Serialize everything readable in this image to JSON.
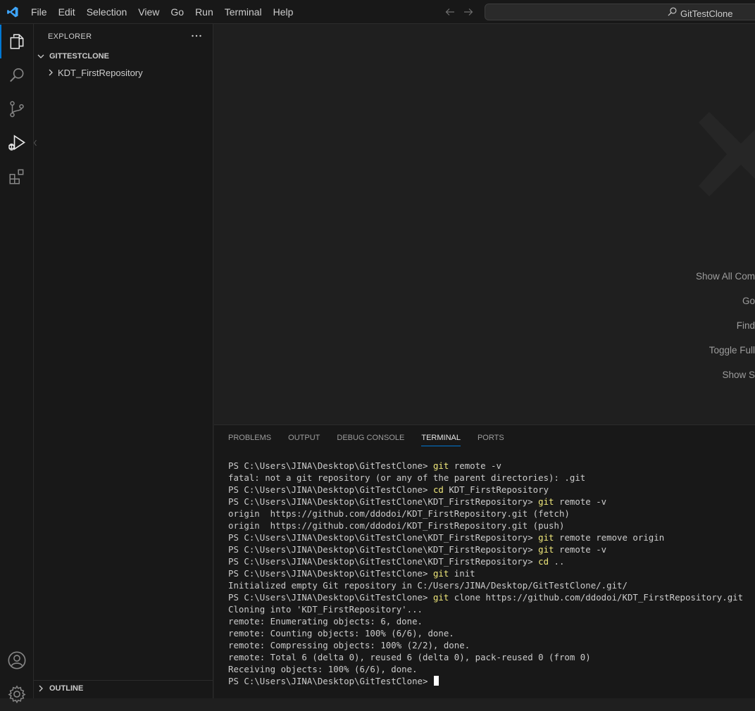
{
  "titlebar": {
    "menu": [
      "File",
      "Edit",
      "Selection",
      "View",
      "Go",
      "Run",
      "Terminal",
      "Help"
    ],
    "command_center": "GitTestClone"
  },
  "colors": {
    "accent": "#0078d4",
    "app_logo": "#3ea6ff",
    "command": "#f0e87b"
  },
  "activity_bar": {
    "icons": [
      "explorer-icon",
      "search-icon",
      "source-control-icon",
      "run-debug-icon",
      "extensions-icon"
    ],
    "bottom_icons": [
      "account-icon",
      "settings-gear-icon"
    ]
  },
  "sidebar": {
    "title": "EXPLORER",
    "more_icon": "ellipsis-icon",
    "workspace": "GITTESTCLONE",
    "items": [
      {
        "label": "KDT_FirstRepository"
      }
    ],
    "outline": "OUTLINE"
  },
  "editor": {
    "shortcuts": [
      "Show All Com",
      "Go",
      "Find",
      "Toggle Full",
      "Show S"
    ]
  },
  "panel": {
    "tabs": [
      "PROBLEMS",
      "OUTPUT",
      "DEBUG CONSOLE",
      "TERMINAL",
      "PORTS"
    ],
    "active_tab": "TERMINAL",
    "terminal_lines": [
      {
        "prompt": "PS C:\\Users\\JINA\\Desktop\\GitTestClone> ",
        "git": "git",
        "rest": " remote -v"
      },
      {
        "text": "fatal: not a git repository (or any of the parent directories): .git"
      },
      {
        "prompt": "PS C:\\Users\\JINA\\Desktop\\GitTestClone> ",
        "git": "cd",
        "rest": " KDT_FirstRepository"
      },
      {
        "prompt": "PS C:\\Users\\JINA\\Desktop\\GitTestClone\\KDT_FirstRepository> ",
        "git": "git",
        "rest": " remote -v"
      },
      {
        "text": "origin  https://github.com/ddodoi/KDT_FirstRepository.git (fetch)"
      },
      {
        "text": "origin  https://github.com/ddodoi/KDT_FirstRepository.git (push)"
      },
      {
        "prompt": "PS C:\\Users\\JINA\\Desktop\\GitTestClone\\KDT_FirstRepository> ",
        "git": "git",
        "rest": " remote remove origin"
      },
      {
        "prompt": "PS C:\\Users\\JINA\\Desktop\\GitTestClone\\KDT_FirstRepository> ",
        "git": "git",
        "rest": " remote -v"
      },
      {
        "prompt": "PS C:\\Users\\JINA\\Desktop\\GitTestClone\\KDT_FirstRepository> ",
        "git": "cd",
        "rest": " .."
      },
      {
        "prompt": "PS C:\\Users\\JINA\\Desktop\\GitTestClone> ",
        "git": "git",
        "rest": " init"
      },
      {
        "text": "Initialized empty Git repository in C:/Users/JINA/Desktop/GitTestClone/.git/"
      },
      {
        "prompt": "PS C:\\Users\\JINA\\Desktop\\GitTestClone> ",
        "git": "git",
        "rest": " clone https://github.com/ddodoi/KDT_FirstRepository.git"
      },
      {
        "text": "Cloning into 'KDT_FirstRepository'..."
      },
      {
        "text": "remote: Enumerating objects: 6, done."
      },
      {
        "text": "remote: Counting objects: 100% (6/6), done."
      },
      {
        "text": "remote: Compressing objects: 100% (2/2), done."
      },
      {
        "text": "remote: Total 6 (delta 0), reused 6 (delta 0), pack-reused 0 (from 0)"
      },
      {
        "text": "Receiving objects: 100% (6/6), done."
      },
      {
        "prompt": "PS C:\\Users\\JINA\\Desktop\\GitTestClone> ",
        "cursor": true
      }
    ]
  }
}
